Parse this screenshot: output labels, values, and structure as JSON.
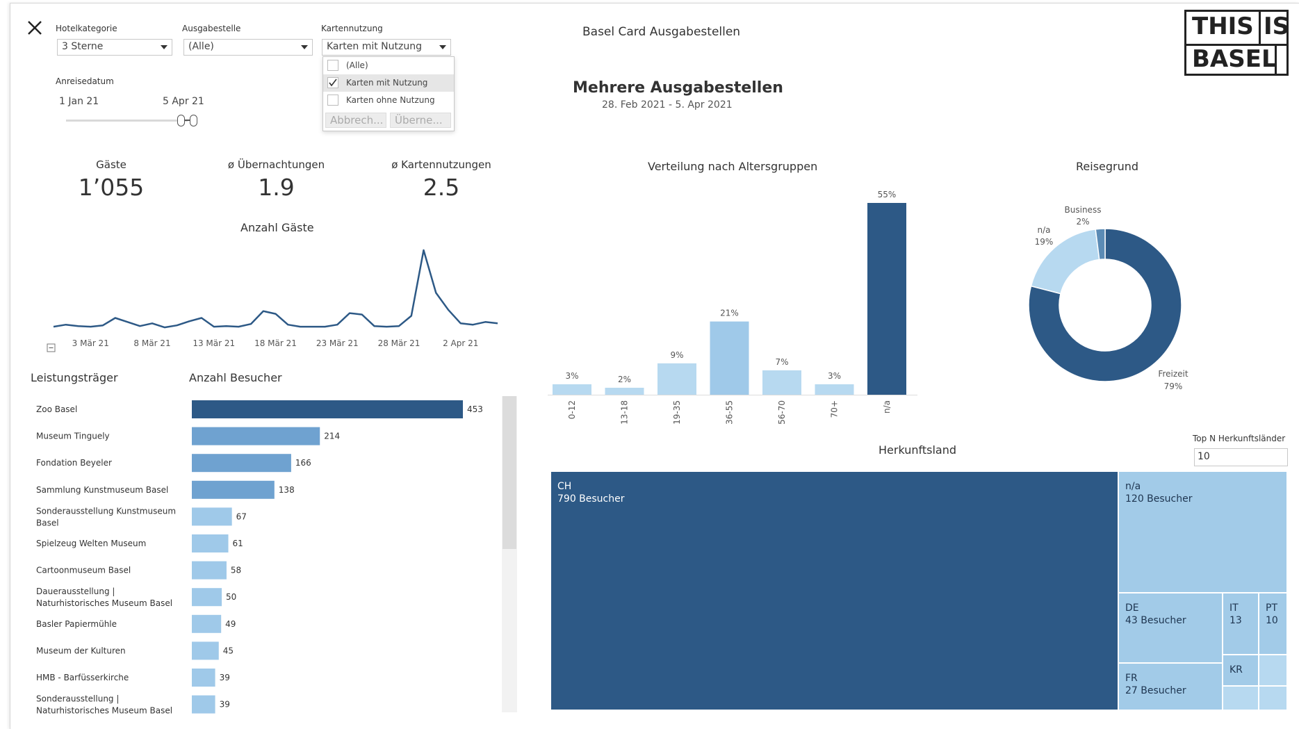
{
  "header": {
    "title": "Basel Card Ausgabestellen",
    "subtitle": "Mehrere Ausgabestellen",
    "daterange": "28. Feb 2021 - 5. Apr 2021",
    "logo_line1_a": "THIS",
    "logo_line1_b": "IS",
    "logo_line2": "BASEL"
  },
  "filters": {
    "hotel": {
      "label": "Hotelkategorie",
      "value": "3 Sterne"
    },
    "ausgabe": {
      "label": "Ausgabestelle",
      "value": "(Alle)"
    },
    "karten": {
      "label": "Kartennutzung",
      "value": "Karten mit Nutzung",
      "options": [
        "(Alle)",
        "Karten mit Nutzung",
        "Karten ohne Nutzung"
      ],
      "cancel": "Abbrech...",
      "apply": "Überne..."
    },
    "anreise": {
      "label": "Anreisedatum",
      "start": "1 Jan 21",
      "end": "5 Apr 21"
    },
    "topn": {
      "label": "Top N Herkunftsländer",
      "value": "10"
    }
  },
  "kpis": [
    {
      "title": "Gäste",
      "value": "1’055"
    },
    {
      "title": "ø Übernachtungen",
      "value": "1.9"
    },
    {
      "title": "ø Kartennutzungen",
      "value": "2.5"
    }
  ],
  "chart_data": [
    {
      "id": "line",
      "type": "line",
      "title": "Anzahl Gäste",
      "x_ticks": [
        "3 Mär 21",
        "8 Mär 21",
        "13 Mär 21",
        "18 Mär 21",
        "23 Mär 21",
        "28 Mär 21",
        "2 Apr 21"
      ],
      "x": [
        "28 Feb",
        "1 Mär",
        "2 Mär",
        "3 Mär",
        "4 Mär",
        "5 Mär",
        "6 Mär",
        "7 Mär",
        "8 Mär",
        "9 Mär",
        "10 Mär",
        "11 Mär",
        "12 Mär",
        "13 Mär",
        "14 Mär",
        "15 Mär",
        "16 Mär",
        "17 Mär",
        "18 Mär",
        "19 Mär",
        "20 Mär",
        "21 Mär",
        "22 Mär",
        "23 Mär",
        "24 Mär",
        "25 Mär",
        "26 Mär",
        "27 Mär",
        "28 Mär",
        "29 Mär",
        "30 Mär",
        "31 Mär",
        "1 Apr",
        "2 Apr",
        "3 Apr",
        "4 Apr",
        "5 Apr"
      ],
      "values": [
        5,
        8,
        6,
        5,
        7,
        18,
        12,
        6,
        10,
        4,
        7,
        13,
        18,
        5,
        6,
        5,
        9,
        28,
        24,
        8,
        5,
        5,
        5,
        8,
        25,
        23,
        6,
        5,
        6,
        21,
        118,
        55,
        30,
        10,
        8,
        12,
        10
      ]
    },
    {
      "id": "bars",
      "type": "bar",
      "orientation": "horizontal",
      "xlabel": "Anzahl Besucher",
      "ylabel": "Leistungsträger",
      "categories": [
        "Zoo Basel",
        "Museum Tinguely",
        "Fondation Beyeler",
        "Sammlung Kunstmuseum Basel",
        "Sonderausstellung Kunstmuseum Basel",
        "Spielzeug Welten Museum",
        "Cartoonmuseum Basel",
        "Dauerausstellung | Naturhistorisches Museum Basel",
        "Basler Papiermühle",
        "Museum der Kulturen",
        "HMB - Barfüsserkirche",
        "Sonderausstellung | Naturhistorisches Museum Basel"
      ],
      "values": [
        453,
        214,
        166,
        138,
        67,
        61,
        58,
        50,
        49,
        45,
        39,
        39
      ]
    },
    {
      "id": "age",
      "type": "bar",
      "title": "Verteilung nach Altersgruppen",
      "categories": [
        "0-12",
        "13-18",
        "19-35",
        "36-55",
        "56-70",
        "70+",
        "n/a"
      ],
      "values": [
        3,
        2,
        9,
        21,
        7,
        3,
        55
      ],
      "labels": [
        "3%",
        "2%",
        "9%",
        "21%",
        "7%",
        "3%",
        "55%"
      ]
    },
    {
      "id": "donut",
      "type": "pie",
      "title": "Reisegrund",
      "slices": [
        {
          "name": "Freizeit",
          "value": 79,
          "label": "79%"
        },
        {
          "name": "n/a",
          "value": 19,
          "label": "19%"
        },
        {
          "name": "Business",
          "value": 2,
          "label": "2%"
        }
      ]
    },
    {
      "id": "treemap",
      "type": "treemap",
      "title": "Herkunftsland",
      "items": [
        {
          "name": "CH",
          "value": 790,
          "label": "790 Besucher"
        },
        {
          "name": "n/a",
          "value": 120,
          "label": "120 Besucher"
        },
        {
          "name": "DE",
          "value": 43,
          "label": "43 Besucher"
        },
        {
          "name": "FR",
          "value": 27,
          "label": "27 Besucher"
        },
        {
          "name": "IT",
          "value": 13,
          "label": "13"
        },
        {
          "name": "PT",
          "value": 10,
          "label": "10"
        },
        {
          "name": "KR",
          "value": null,
          "label": ""
        }
      ]
    }
  ],
  "colors": {
    "dark": "#2d5986",
    "mid": "#6fa2d0",
    "light": "#9fc9e9",
    "lighter": "#b7d9f0",
    "treemap_light": "#a2cbe8"
  }
}
